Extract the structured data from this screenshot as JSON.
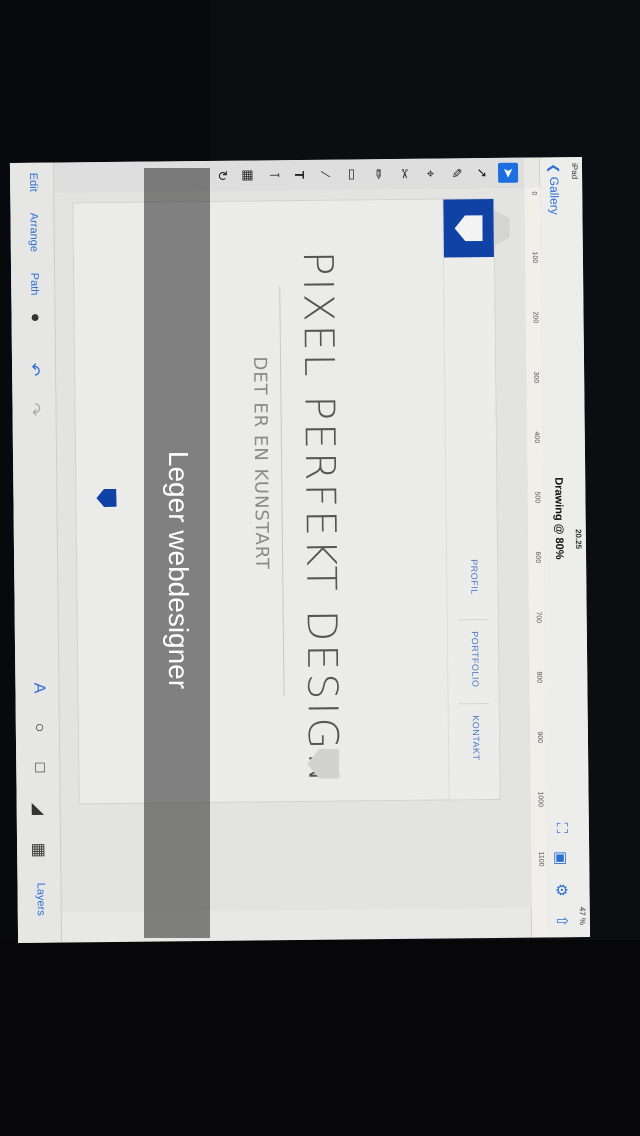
{
  "status": {
    "carrier": "iPad",
    "clock": "20.25",
    "battery": "47 %"
  },
  "nav": {
    "back_label": "Gallery",
    "title": "Drawing @ 80%"
  },
  "ruler": {
    "ticks": [
      "0",
      "100",
      "200",
      "300",
      "400",
      "500",
      "600",
      "700",
      "800",
      "900",
      "1000",
      "1100"
    ]
  },
  "site": {
    "menu": [
      "PROFIL",
      "PORTFOLIO",
      "KONTAKT"
    ],
    "headline": "PIXEL PERFEKT DESIGN",
    "subline": "DET ER EN KUNSTART"
  },
  "bottom_bar": {
    "edit": "Edit",
    "arrange": "Arrange",
    "path": "Path",
    "layers": "Layers"
  },
  "caption": "Leger webdesigner",
  "colors": {
    "accent": "#1041a4",
    "ios_blue": "#2b6fd6"
  }
}
